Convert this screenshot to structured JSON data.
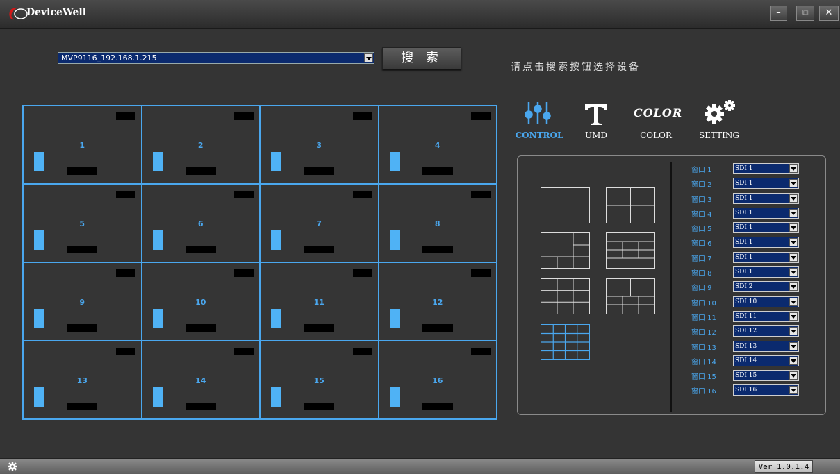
{
  "window": {
    "title": "DeviceWell",
    "minimize": "–",
    "restore": "⧉",
    "close": "✕"
  },
  "device": {
    "selected": "MVP9116_192.168.1.215"
  },
  "search_button": "搜 索",
  "hint": "请点击搜索按钮选择设备",
  "grid_cells": [
    "1",
    "2",
    "3",
    "4",
    "5",
    "6",
    "7",
    "8",
    "9",
    "10",
    "11",
    "12",
    "13",
    "14",
    "15",
    "16"
  ],
  "tabs": {
    "control": "CONTROL",
    "umd": "UMD",
    "color": "COLOR",
    "color_icon_text": "COLOR",
    "setting": "SETTING"
  },
  "windows": [
    {
      "label": "窗口 1",
      "source": "SDI 1"
    },
    {
      "label": "窗口 2",
      "source": "SDI 1"
    },
    {
      "label": "窗口 3",
      "source": "SDI 1"
    },
    {
      "label": "窗口 4",
      "source": "SDI 1"
    },
    {
      "label": "窗口 5",
      "source": "SDI 1"
    },
    {
      "label": "窗口 6",
      "source": "SDI 1"
    },
    {
      "label": "窗口 7",
      "source": "SDI 1"
    },
    {
      "label": "窗口 8",
      "source": "SDI 1"
    },
    {
      "label": "窗口 9",
      "source": "SDI 2"
    },
    {
      "label": "窗口 10",
      "source": "SDI 10"
    },
    {
      "label": "窗口 11",
      "source": "SDI 11"
    },
    {
      "label": "窗口 12",
      "source": "SDI 12"
    },
    {
      "label": "窗口 13",
      "source": "SDI 13"
    },
    {
      "label": "窗口 14",
      "source": "SDI 14"
    },
    {
      "label": "窗口 15",
      "source": "SDI 15"
    },
    {
      "label": "窗口 16",
      "source": "SDI 16"
    }
  ],
  "version": "Ver 1.0.1.4",
  "colors": {
    "accent": "#4aa7ee",
    "background": "#343434",
    "select_bg": "#0b2a6e"
  }
}
